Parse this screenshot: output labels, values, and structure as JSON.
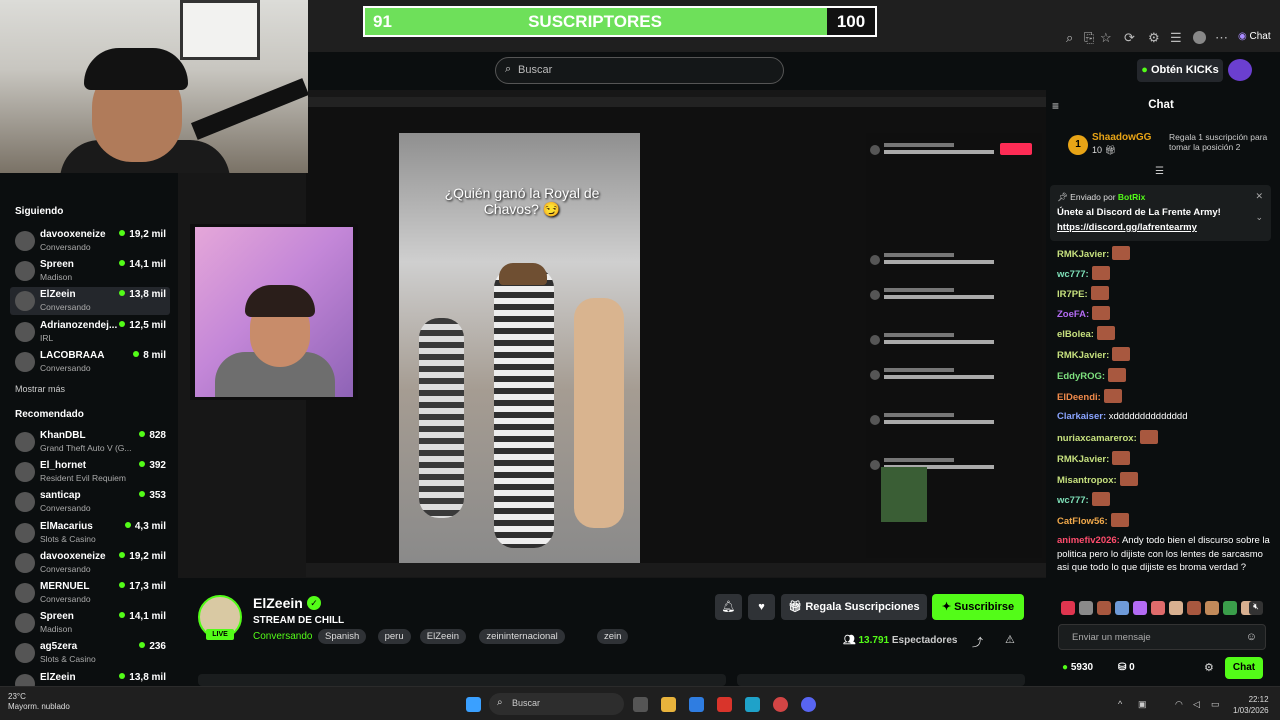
{
  "goal": {
    "current": "91",
    "label": "SUSCRIPTORES",
    "target": "100",
    "progress_fraction": 0.91,
    "accent": "#6ee05a"
  },
  "browser": {
    "profile_label": "Chat"
  },
  "topbar": {
    "search_placeholder": "Buscar",
    "get_kicks": "Obtén KICKs"
  },
  "sidebar": {
    "following_title": "Siguiendo",
    "following": [
      {
        "name": "davooxeneize",
        "status": "Conversando",
        "viewers": "19,2 mil"
      },
      {
        "name": "Spreen",
        "status": "Madison",
        "viewers": "14,1 mil"
      },
      {
        "name": "ElZeein",
        "status": "Conversando",
        "viewers": "13,8 mil",
        "active": true
      },
      {
        "name": "Adrianozendej...",
        "status": "IRL",
        "viewers": "12,5 mil"
      },
      {
        "name": "LACOBRAAA",
        "status": "Conversando",
        "viewers": "8 mil"
      }
    ],
    "show_more": "Mostrar más",
    "recommended_title": "Recomendado",
    "recommended": [
      {
        "name": "KhanDBL",
        "status": "Grand Theft Auto V (G...",
        "viewers": "828"
      },
      {
        "name": "El_hornet",
        "status": "Resident Evil Requiem",
        "viewers": "392"
      },
      {
        "name": "santicap",
        "status": "Conversando",
        "viewers": "353"
      },
      {
        "name": "ElMacarius",
        "status": "Slots & Casino",
        "viewers": "4,3 mil"
      },
      {
        "name": "davooxeneize",
        "status": "Conversando",
        "viewers": "19,2 mil"
      },
      {
        "name": "MERNUEL",
        "status": "Conversando",
        "viewers": "17,3 mil"
      },
      {
        "name": "Spreen",
        "status": "Madison",
        "viewers": "14,1 mil"
      },
      {
        "name": "ag5zera",
        "status": "Slots & Casino",
        "viewers": "236"
      },
      {
        "name": "ElZeein",
        "status": "",
        "viewers": "13,8 mil"
      }
    ]
  },
  "video": {
    "caption": "¿Quién ganó la Royal de Chavos? 😏"
  },
  "stream": {
    "channel": "ElZeein",
    "live": "LIVE",
    "title": "STREAM DE CHILL",
    "category": "Conversando",
    "tags": [
      "Spanish",
      "peru",
      "ElZeein",
      "zeininternacional",
      "zein"
    ],
    "gift_button": "Regala Suscripciones",
    "subscribe_button": "Suscribirse",
    "viewers": "13.791",
    "viewers_label": "Espectadores"
  },
  "chat": {
    "title": "Chat",
    "gift": {
      "rank": "1",
      "user": "ShaadowGG",
      "count": "10",
      "text": "Regala 1 suscripción para tomar la posición 2"
    },
    "pinned": {
      "sent_by_label": "Enviado por",
      "sender": "BotRix",
      "line1": "Únete al Discord de La Frente Army!",
      "link": "https://discord.gg/lafrentearmy"
    },
    "messages": [
      {
        "user": "RMKJavier:",
        "color": "#c6e07e",
        "text": "",
        "emote": true
      },
      {
        "user": "wc777:",
        "color": "#7ee0b8",
        "text": "",
        "emote": true
      },
      {
        "user": "IR7PE:",
        "color": "#c6e07e",
        "text": "",
        "emote": true
      },
      {
        "user": "ZoeFA:",
        "color": "#b36bf3",
        "text": "",
        "emote": true
      },
      {
        "user": "elBolea:",
        "color": "#c6e07e",
        "text": "",
        "emote": true
      },
      {
        "user": "RMKJavier:",
        "color": "#c6e07e",
        "text": "",
        "emote": true
      },
      {
        "user": "EddyROG:",
        "color": "#7ee07e",
        "text": "",
        "emote": true
      },
      {
        "user": "ElDeendi:",
        "color": "#f08a4b",
        "text": "",
        "emote": true
      },
      {
        "user": "Clarkaiser:",
        "color": "#8aa4ff",
        "text": "xdddddddddddddd",
        "emote": false
      },
      {
        "user": "nuriaxcamarerox:",
        "color": "#c6e07e",
        "text": "",
        "emote": true
      },
      {
        "user": "RMKJavier:",
        "color": "#c6e07e",
        "text": "",
        "emote": true
      },
      {
        "user": "Misantropox:",
        "color": "#c6e07e",
        "text": "",
        "emote": true
      },
      {
        "user": "wc777:",
        "color": "#7ee0b8",
        "text": "",
        "emote": true
      },
      {
        "user": "CatFlow56:",
        "color": "#f0a84b",
        "text": "",
        "emote": true
      },
      {
        "user": "animefiv2026:",
        "color": "#ff4d6d",
        "text": "Andy todo bien el discurso sobre la politica pero lo dijiste con los lentes de sarcasmo asi que todo lo que dijiste es broma verdad ?",
        "emote": false
      }
    ],
    "input_placeholder": "Enviar un mensaje",
    "points": "5930",
    "rewards": "0",
    "send_button": "Chat"
  },
  "taskbar": {
    "weather_temp": "23°C",
    "weather_desc": "Mayorm. nublado",
    "search": "Buscar",
    "time": "22:12",
    "date": "1/03/2026"
  }
}
